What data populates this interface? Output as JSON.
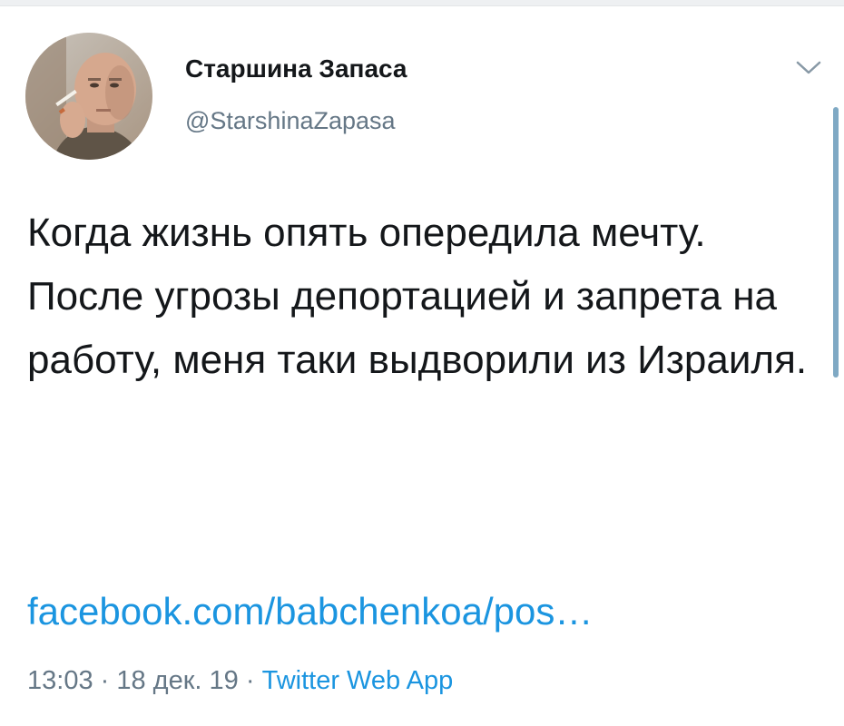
{
  "tweet": {
    "display_name": "Старшина Запаса",
    "handle": "@StarshinaZapasa",
    "text": "Когда жизнь опять опередила мечту. После угрозы депортацией и запрета на работу, меня таки выдворили из Израиля.",
    "link": "facebook.com/babchenkoa/pos…",
    "time": "13:03",
    "separator": " · ",
    "date": "18 дек. 19",
    "source": "Twitter Web App"
  },
  "icons": {
    "menu": "chevron-down-icon"
  },
  "colors": {
    "link": "#1b95e0",
    "secondary_text": "#657786",
    "primary_text": "#14171a",
    "scrollbar": "#7fa9c4"
  }
}
